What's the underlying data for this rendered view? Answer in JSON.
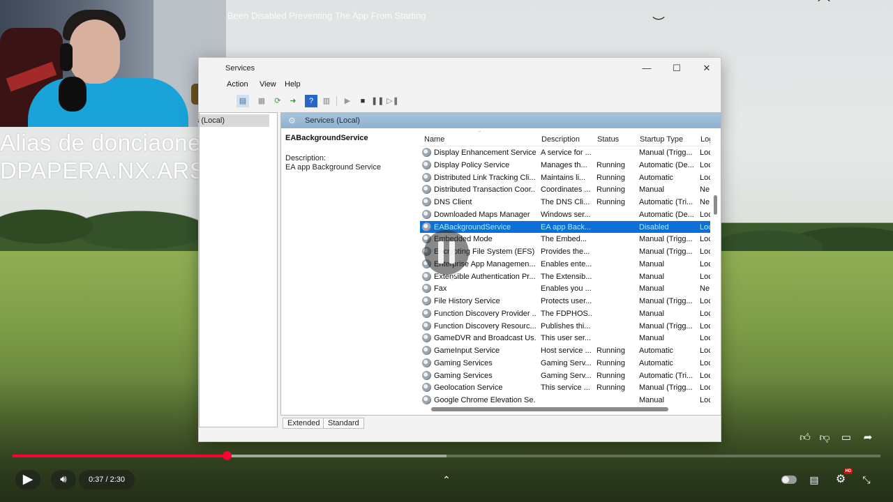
{
  "video": {
    "title_snippet": "Been Disabled Preventing The App From Starting"
  },
  "overlay": {
    "line1": "Alias de donciaones",
    "line2": "DPAPERA.NX.ARS"
  },
  "window": {
    "title": "Services",
    "controls": {
      "minimize": "—",
      "maximize": "☐",
      "close": "✕"
    },
    "menu": [
      "Action",
      "View",
      "Help"
    ],
    "tree": {
      "node": "Services (Local)"
    },
    "header_title": "Services (Local)",
    "selected": {
      "name": "EABackgroundService",
      "description_label": "Description:",
      "description": "EA app Background Service"
    },
    "columns": {
      "name": "Name",
      "description": "Description",
      "status": "Status",
      "startup": "Startup Type",
      "logon": "Log"
    },
    "rows": [
      {
        "name": "Display Enhancement Service",
        "desc": "A service for ...",
        "status": "",
        "startup": "Manual (Trigg...",
        "logon": "Loc"
      },
      {
        "name": "Display Policy Service",
        "desc": "Manages th...",
        "status": "Running",
        "startup": "Automatic (De...",
        "logon": "Loc"
      },
      {
        "name": "Distributed Link Tracking Cli...",
        "desc": "Maintains li...",
        "status": "Running",
        "startup": "Automatic",
        "logon": "Loc"
      },
      {
        "name": "Distributed Transaction Coor...",
        "desc": "Coordinates ...",
        "status": "Running",
        "startup": "Manual",
        "logon": "Ne"
      },
      {
        "name": "DNS Client",
        "desc": "The DNS Cli...",
        "status": "Running",
        "startup": "Automatic (Tri...",
        "logon": "Ne"
      },
      {
        "name": "Downloaded Maps Manager",
        "desc": "Windows ser...",
        "status": "",
        "startup": "Automatic (De...",
        "logon": "Loc"
      },
      {
        "name": "EABackgroundService",
        "desc": "EA app Back...",
        "status": "",
        "startup": "Disabled",
        "logon": "Loc",
        "selected": true
      },
      {
        "name": "Embedded Mode",
        "desc": "The Embed...",
        "status": "",
        "startup": "Manual (Trigg...",
        "logon": "Loc"
      },
      {
        "name": "Encrypting File System (EFS)",
        "desc": "Provides the...",
        "status": "",
        "startup": "Manual (Trigg...",
        "logon": "Loc"
      },
      {
        "name": "Enterprise App Managemen...",
        "desc": "Enables ente...",
        "status": "",
        "startup": "Manual",
        "logon": "Loc"
      },
      {
        "name": "Extensible Authentication Pr...",
        "desc": "The Extensib...",
        "status": "",
        "startup": "Manual",
        "logon": "Loc"
      },
      {
        "name": "Fax",
        "desc": "Enables you ...",
        "status": "",
        "startup": "Manual",
        "logon": "Ne"
      },
      {
        "name": "File History Service",
        "desc": "Protects user...",
        "status": "",
        "startup": "Manual (Trigg...",
        "logon": "Loc"
      },
      {
        "name": "Function Discovery Provider ...",
        "desc": "The FDPHOS...",
        "status": "",
        "startup": "Manual",
        "logon": "Loc"
      },
      {
        "name": "Function Discovery Resourc...",
        "desc": "Publishes thi...",
        "status": "",
        "startup": "Manual (Trigg...",
        "logon": "Loc"
      },
      {
        "name": "GameDVR and Broadcast Us...",
        "desc": "This user ser...",
        "status": "",
        "startup": "Manual",
        "logon": "Loc"
      },
      {
        "name": "GameInput Service",
        "desc": "Host service ...",
        "status": "Running",
        "startup": "Automatic",
        "logon": "Loc"
      },
      {
        "name": "Gaming Services",
        "desc": "Gaming Serv...",
        "status": "Running",
        "startup": "Automatic",
        "logon": "Loc"
      },
      {
        "name": "Gaming Services",
        "desc": "Gaming Serv...",
        "status": "Running",
        "startup": "Automatic (Tri...",
        "logon": "Loc"
      },
      {
        "name": "Geolocation Service",
        "desc": "This service ...",
        "status": "Running",
        "startup": "Manual (Trigg...",
        "logon": "Loc"
      },
      {
        "name": "Google Chrome Elevation Se...",
        "desc": "",
        "status": "",
        "startup": "Manual",
        "logon": "Loc"
      }
    ],
    "tabs": [
      "Extended",
      "Standard"
    ]
  },
  "player": {
    "time": "0:37 / 2:30",
    "progress_fraction": 0.247,
    "buffer_fraction": 0.5,
    "hd_badge": "HD",
    "accent": "#ff0033",
    "icons": {
      "play": "play-icon",
      "volume": "volume-icon",
      "chevron": "chevron-up-icon",
      "autoplay": "autoplay-toggle",
      "subtitles": "subtitles-icon",
      "settings": "gear-icon",
      "fullscreen": "exit-fullscreen-icon",
      "like": "thumb-up-icon",
      "dislike": "thumb-down-icon",
      "comments": "comment-icon",
      "share": "share-icon"
    }
  }
}
